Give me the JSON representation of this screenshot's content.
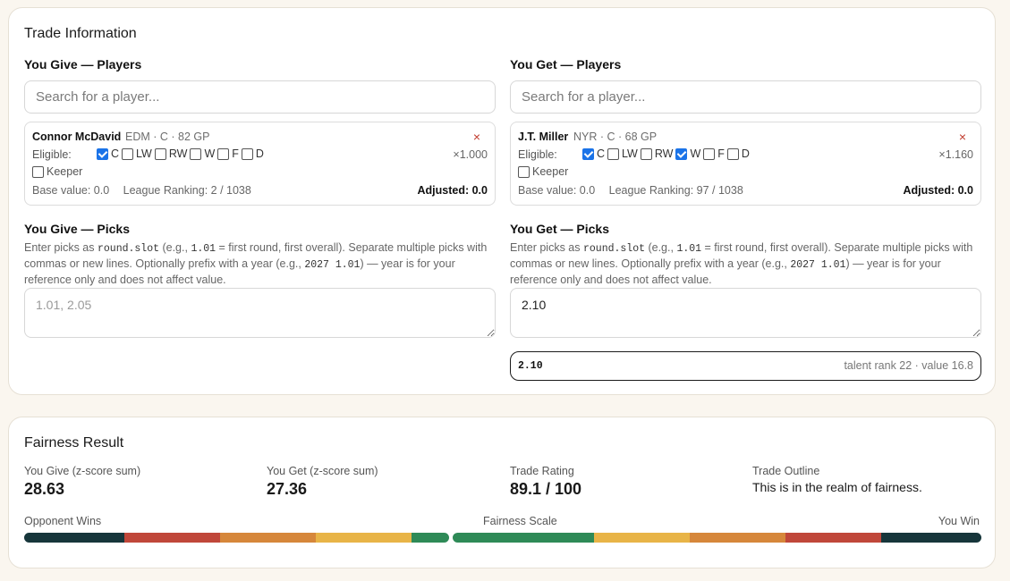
{
  "trade": {
    "title": "Trade Information",
    "give": {
      "players_heading": "You Give — Players",
      "search_placeholder": "Search for a player...",
      "player": {
        "name": "Connor McDavid",
        "meta": "EDM · C · 82 GP",
        "remove": "×",
        "eligible_label": "Eligible:",
        "positions": [
          {
            "label": "C",
            "checked": true
          },
          {
            "label": "LW",
            "checked": false
          },
          {
            "label": "RW",
            "checked": false
          },
          {
            "label": "W",
            "checked": false
          },
          {
            "label": "F",
            "checked": false
          },
          {
            "label": "D",
            "checked": false
          }
        ],
        "multiplier": "×1.000",
        "keeper_label": "Keeper",
        "keeper_checked": false,
        "base_value": "Base value: 0.0",
        "ranking": "League Ranking: 2 / 1038",
        "adjusted": "Adjusted: 0.0"
      },
      "picks_heading": "You Give — Picks",
      "picks_placeholder": "1.01, 2.05",
      "picks_value": ""
    },
    "get": {
      "players_heading": "You Get — Players",
      "search_placeholder": "Search for a player...",
      "player": {
        "name": "J.T. Miller",
        "meta": "NYR · C · 68 GP",
        "remove": "×",
        "eligible_label": "Eligible:",
        "positions": [
          {
            "label": "C",
            "checked": true
          },
          {
            "label": "LW",
            "checked": false
          },
          {
            "label": "RW",
            "checked": false
          },
          {
            "label": "W",
            "checked": true
          },
          {
            "label": "F",
            "checked": false
          },
          {
            "label": "D",
            "checked": false
          }
        ],
        "multiplier": "×1.160",
        "keeper_label": "Keeper",
        "keeper_checked": false,
        "base_value": "Base value: 0.0",
        "ranking": "League Ranking: 97 / 1038",
        "adjusted": "Adjusted: 0.0"
      },
      "picks_heading": "You Get — Picks",
      "picks_placeholder": "",
      "picks_value": "2.10",
      "parsed_pick": {
        "id": "2.10",
        "info": "talent rank 22 · value 16.8"
      }
    },
    "help": {
      "t1": "Enter picks as ",
      "code1": "round.slot",
      "t2": " (e.g., ",
      "code2": "1.01",
      "t3": " = first round, first overall). Separate multiple picks with commas or new lines. Optionally prefix with a year (e.g., ",
      "code3": "2027 1.01",
      "t4": ") — year is for your reference only and does not affect value."
    }
  },
  "fairness": {
    "title": "Fairness Result",
    "give_label": "You Give (z-score sum)",
    "give_value": "28.63",
    "get_label": "You Get (z-score sum)",
    "get_value": "27.36",
    "rating_label": "Trade Rating",
    "rating_value": "89.1 / 100",
    "outline_label": "Trade Outline",
    "outline_value": "This is in the realm of fairness.",
    "scale_left": "Opponent Wins",
    "scale_center": "Fairness Scale",
    "scale_right": "You Win",
    "rating_fraction": 0.891
  },
  "colors": {
    "dark": "#17363b",
    "red": "#c0473a",
    "orange": "#d6873b",
    "yellow": "#e8b447",
    "green": "#2e8a57",
    "checkbox": "#1a73e8"
  }
}
